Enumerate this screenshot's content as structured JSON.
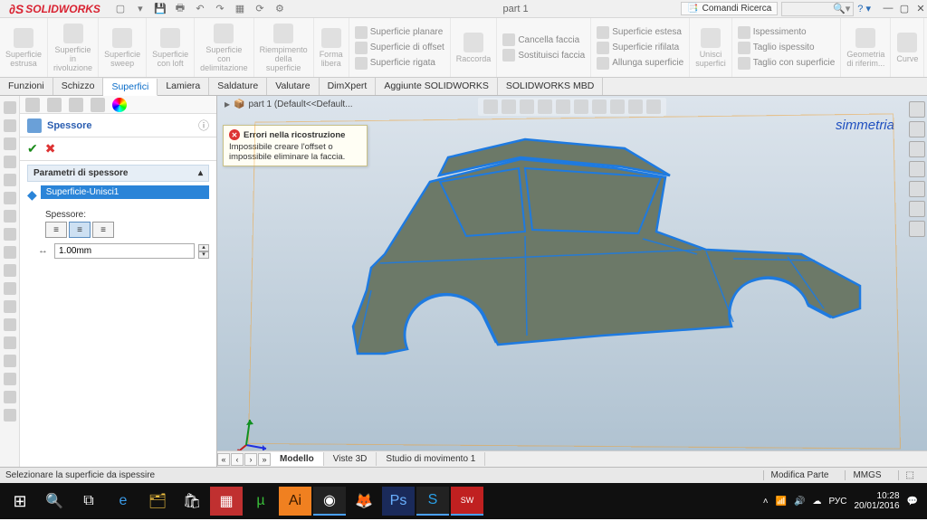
{
  "title": {
    "app": "SOLIDWORKS",
    "doc": "part 1",
    "search_btn": "Comandi Ricerca"
  },
  "ribbon": {
    "g1": "Superficie\nestrusa",
    "g2": "Superficie\nin\nrivoluzione",
    "g3": "Superficie\nsweep",
    "g4": "Superficie\ncon loft",
    "g5": "Superficie\ncon\ndelimitazione",
    "g6": "Riempimento\ndella\nsuperficie",
    "g7": "Forma\nlibera",
    "planare": "Superficie planare",
    "offset": "Superficie di offset",
    "raccorda": "Raccorda",
    "rigata": "Superficie rigata",
    "cancella": "Cancella faccia",
    "sostituisci": "Sostituisci faccia",
    "estesa": "Superficie estesa",
    "rifilata": "Superficie rifilata",
    "allunga": "Allunga superficie",
    "unisci": "Unisci\nsuperfici",
    "ispessimento": "Ispessimento",
    "taglio_isp": "Taglio ispessito",
    "taglio_sup": "Taglio con superficie",
    "geom": "Geometria\ndi riferim...",
    "curve": "Curve"
  },
  "tabs": [
    "Funzioni",
    "Schizzo",
    "Superfici",
    "Lamiera",
    "Saldature",
    "Valutare",
    "DimXpert",
    "Aggiunte SOLIDWORKS",
    "SOLIDWORKS MBD"
  ],
  "active_tab": 2,
  "panel": {
    "title": "Spessore",
    "section": "Parametri di spessore",
    "selected": "Superficie-Unisci1",
    "label": "Spessore:",
    "value": "1.00mm"
  },
  "viewport": {
    "breadcrumb": "part 1  (Default<<Default...",
    "error_title": "Errori nella ricostruzione",
    "error_body": "Impossibile creare l'offset o impossibile eliminare la faccia.",
    "simmetria": "simmetria"
  },
  "bottom_tabs": [
    "Modello",
    "Viste 3D",
    "Studio di movimento 1"
  ],
  "status": {
    "msg": "Selezionare la superficie da ispessire",
    "mode": "Modifica Parte",
    "units": "MMGS"
  },
  "tray": {
    "lang": "РУС",
    "time": "10:28",
    "date": "20/01/2016"
  }
}
